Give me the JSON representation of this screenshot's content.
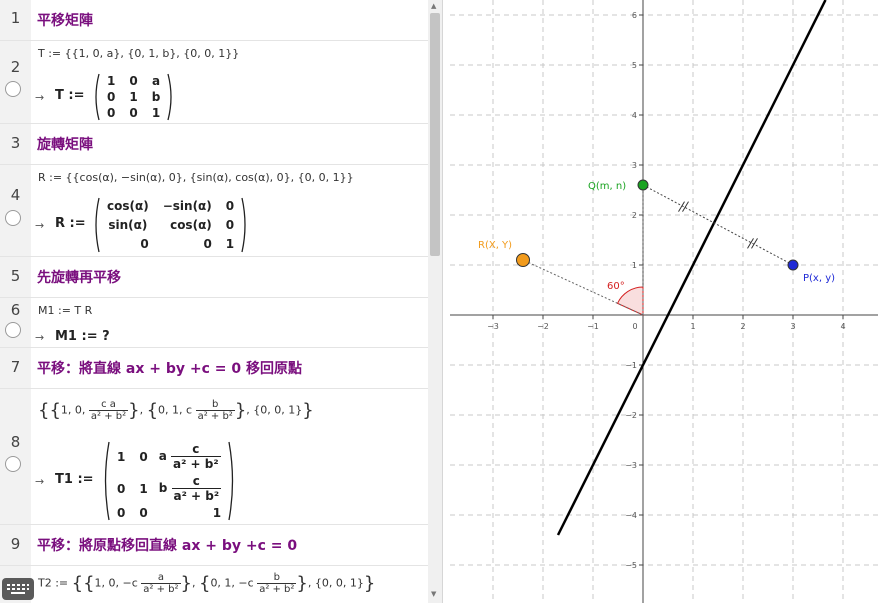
{
  "algebra": {
    "rows": [
      {
        "num": "1",
        "title": "平移矩陣"
      },
      {
        "num": "2",
        "input": "T := {{1, 0, a}, {0, 1, b}, {0, 0, 1}}",
        "output_lhs": "T :=",
        "matrix": [
          [
            "1",
            "0",
            "a"
          ],
          [
            "0",
            "1",
            "b"
          ],
          [
            "0",
            "0",
            "1"
          ]
        ]
      },
      {
        "num": "3",
        "title": "旋轉矩陣"
      },
      {
        "num": "4",
        "input": "R := {{cos(α), −sin(α), 0}, {sin(α), cos(α), 0}, {0, 0, 1}}",
        "output_lhs": "R :=",
        "matrix": [
          [
            "cos(α)",
            "−sin(α)",
            "0"
          ],
          [
            "sin(α)",
            "cos(α)",
            "0"
          ],
          [
            "0",
            "0",
            "1"
          ]
        ]
      },
      {
        "num": "5",
        "title": "先旋轉再平移"
      },
      {
        "num": "6",
        "input": "M1 := T R",
        "output": "M1 := ?"
      },
      {
        "num": "7",
        "title": "平移：將直線 ax + by +c = 0 移回原點"
      },
      {
        "num": "8",
        "input_parts": {
          "p1": "1, 0,",
          "p1_coef": "c a",
          "p1_den": "a² + b²",
          "p2": "0, 1, c",
          "p2_num": "b",
          "p2_den": "a² + b²",
          "p3": "{0, 0, 1}"
        },
        "output_lhs": "T1 :=",
        "matrix": [
          [
            "1",
            "0",
            "a"
          ],
          [
            "0",
            "1",
            "b"
          ],
          [
            "0",
            "0",
            "1"
          ]
        ],
        "frac_num": "c",
        "frac_den": "a² + b²"
      },
      {
        "num": "9",
        "title": "平移：將原點移回直線 ax + by +c = 0"
      },
      {
        "num": "10",
        "input_parts": {
          "p1": "1, 0, −c",
          "p1_num": "a",
          "p1_den": "a² + b²",
          "p2": "0, 1, −c",
          "p2_num": "b",
          "p2_den": "a² + b²",
          "p3": "{0, 0, 1}"
        }
      }
    ]
  },
  "graphics": {
    "x_ticks": [
      "−3",
      "−2",
      "−1",
      "0",
      "1",
      "2",
      "3",
      "4"
    ],
    "y_ticks": [
      "6",
      "5",
      "4",
      "3",
      "2",
      "1",
      "−1",
      "−2",
      "−3",
      "−4",
      "−5"
    ],
    "points": [
      {
        "label": "Q(m, n)",
        "x": 0,
        "y": 2.6,
        "color": "#1aa321"
      },
      {
        "label": "R(X, Y)",
        "x": -2.4,
        "y": 1.1,
        "color": "#f29b1c"
      },
      {
        "label": "P(x, y)",
        "x": 3,
        "y": 1,
        "color": "#1f2ad6"
      }
    ],
    "angle_label": "60°",
    "line_color": "#000000",
    "angle_color": "#d42020"
  }
}
